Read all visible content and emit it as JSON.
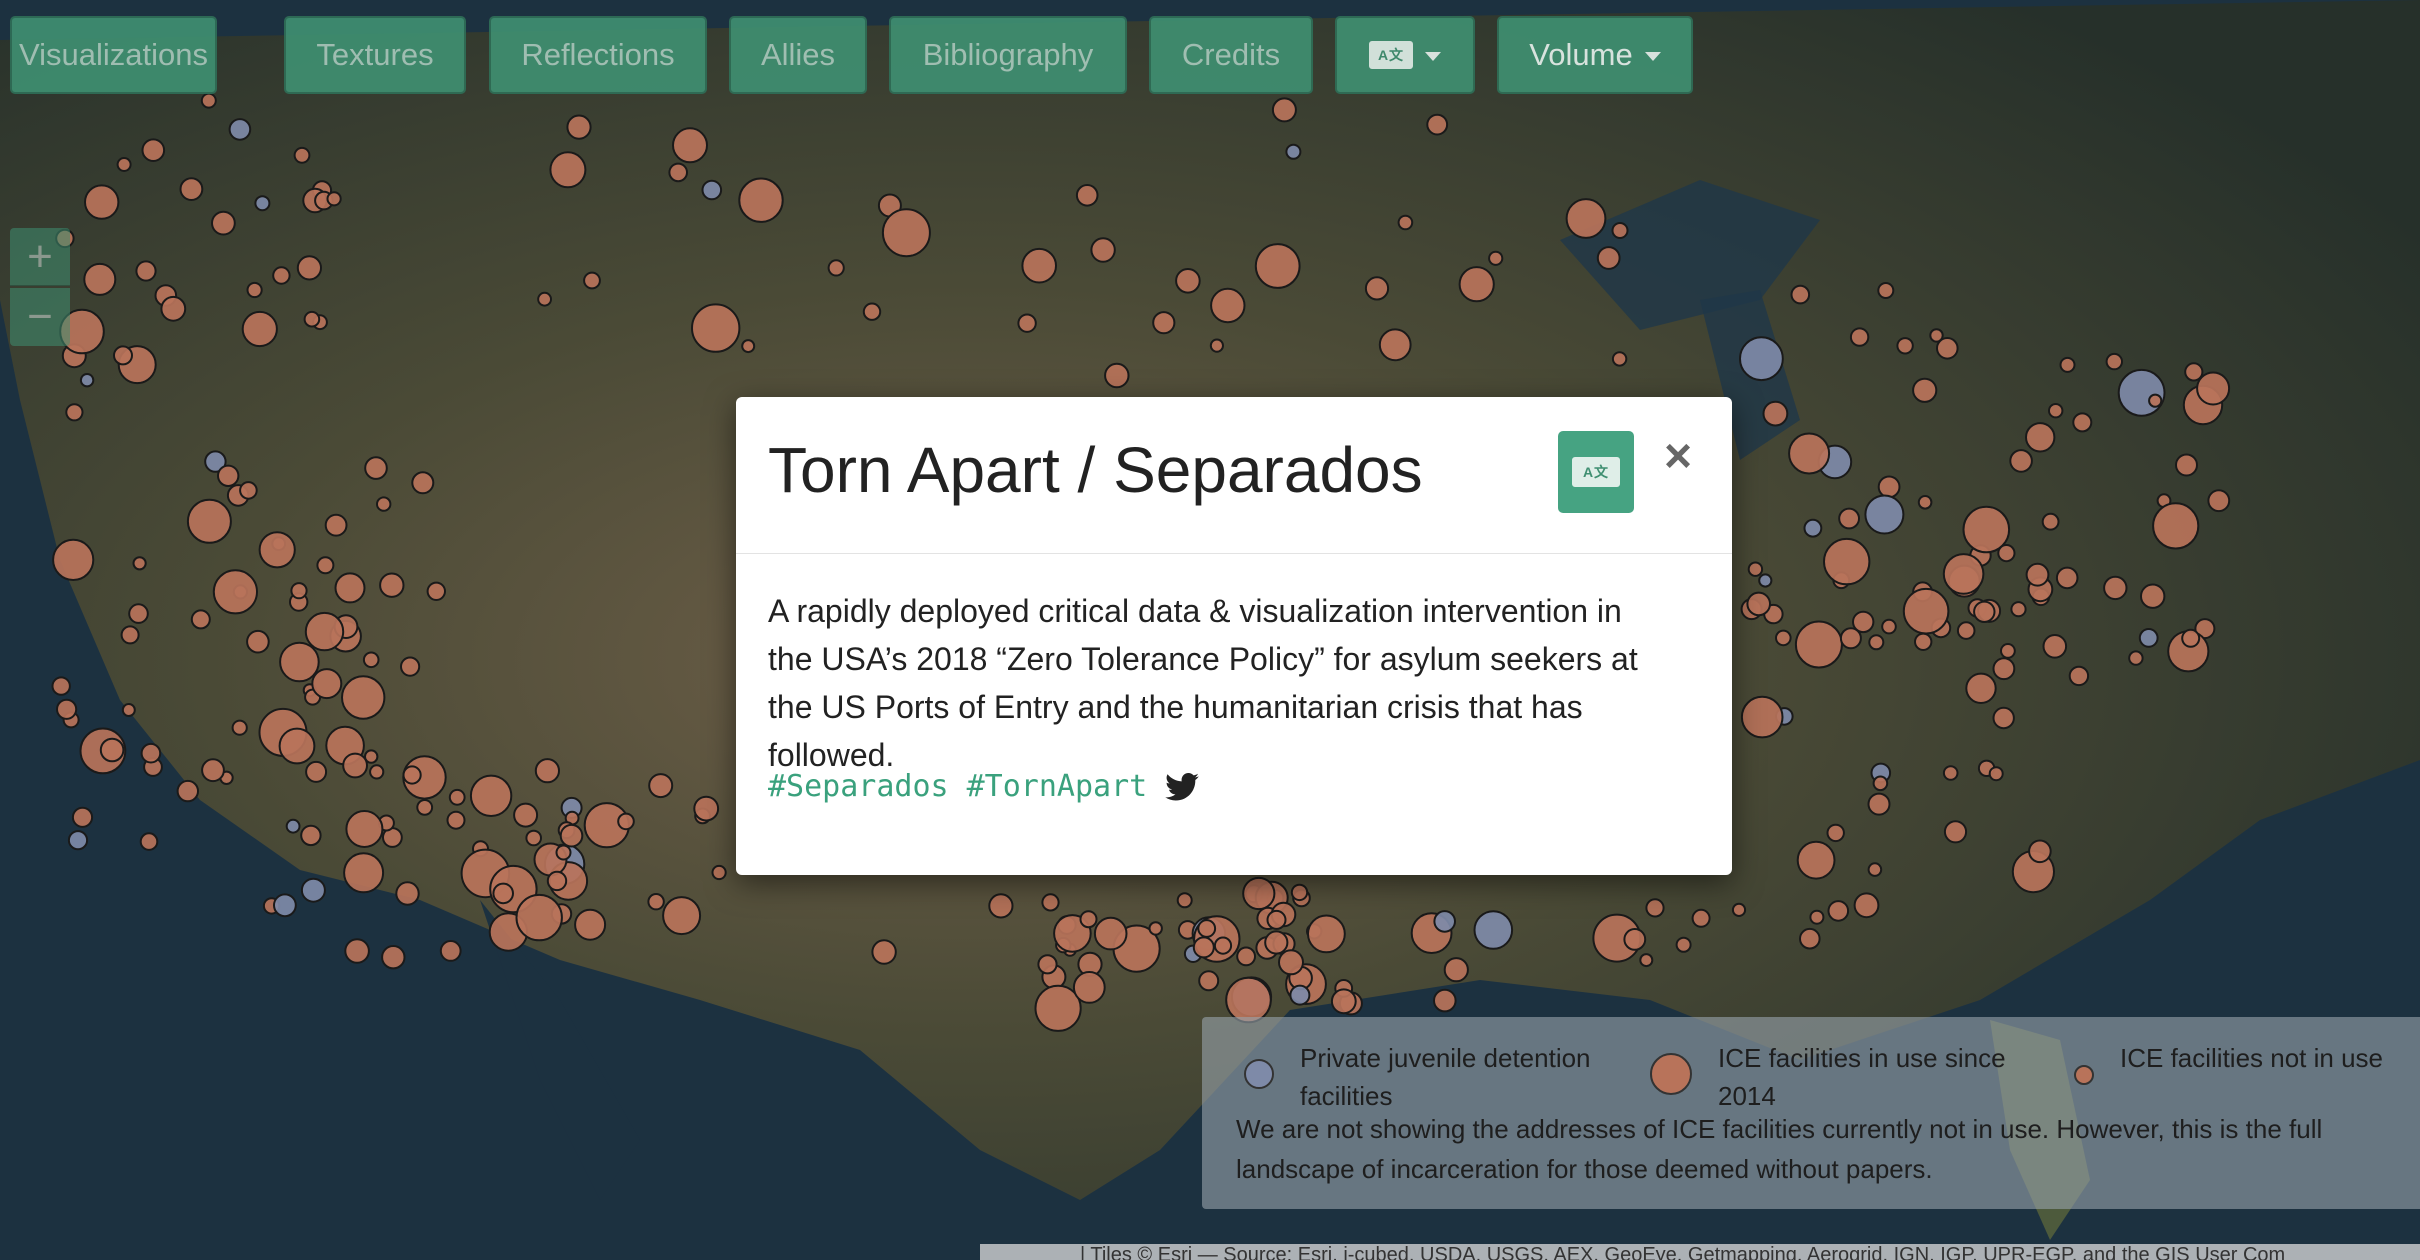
{
  "nav": {
    "items": [
      "Visualizations",
      "Textures",
      "Reflections",
      "Allies",
      "Bibliography",
      "Credits"
    ],
    "language_menu_icon": "translate-icon",
    "volume_label": "Volume"
  },
  "zoom": {
    "in_label": "+",
    "out_label": "−"
  },
  "modal": {
    "title": "Torn Apart / Separados",
    "description": "A rapidly deployed critical data & visualization intervention in the USA’s 2018 “Zero Tolerance Policy” for asylum seekers at the US Ports of Entry and the humanitarian crisis that has followed.",
    "hashtags": [
      "#Separados",
      "#TornApart"
    ],
    "close_label": "×",
    "twitter_icon": "twitter-icon"
  },
  "legend": {
    "items": [
      {
        "label": "Private juvenile detention facilities",
        "color": "#7e8aa8"
      },
      {
        "label": "ICE facilities in use since 2014",
        "color": "#b8735a"
      },
      {
        "label": "ICE facilities not in use",
        "color": "#b8735a"
      }
    ],
    "note": "We are not showing the addresses of ICE facilities currently not in use. However, this is the full landscape of incarceration for those deemed without papers."
  },
  "attribution": "| Tiles © Esri — Source: Esri, i-cubed, USDA, USGS, AEX, GeoEye, Getmapping, Aerogrid, IGN, IGP, UPR-EGP, and the GIS User Com",
  "colors": {
    "accent": "#46a382",
    "marker": "#b8735a",
    "marker_private": "#7e8aa8",
    "hashtag": "#3aa17d"
  }
}
